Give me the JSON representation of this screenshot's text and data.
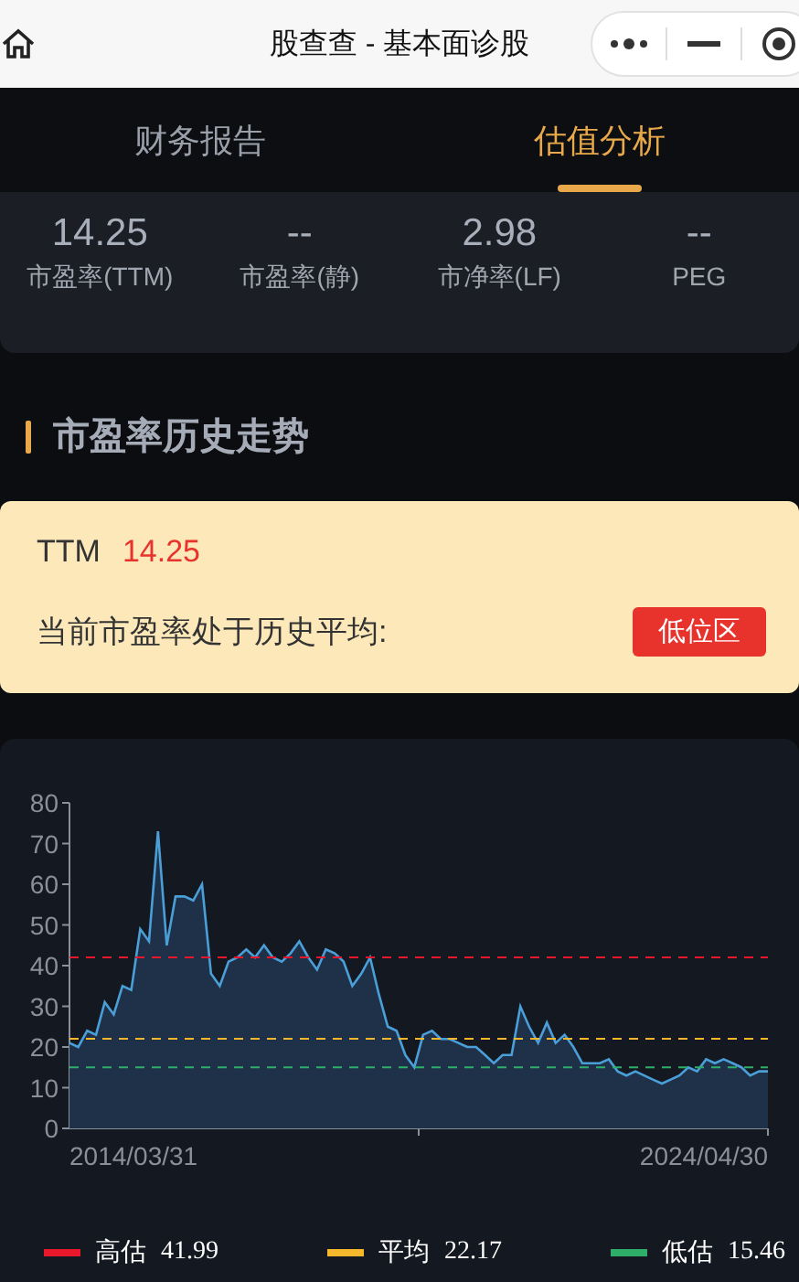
{
  "window": {
    "title": "股查查 - 基本面诊股"
  },
  "tabs": [
    {
      "label": "财务报告",
      "selected": false
    },
    {
      "label": "估值分析",
      "selected": true
    }
  ],
  "metrics": [
    {
      "value": "14.25",
      "label": "市盈率(TTM)"
    },
    {
      "value": "--",
      "label": "市盈率(静)"
    },
    {
      "value": "2.98",
      "label": "市净率(LF)"
    },
    {
      "value": "--",
      "label": "PEG"
    }
  ],
  "section_title": "市盈率历史走势",
  "summary": {
    "label": "TTM",
    "value": "14.25",
    "text": "当前市盈率处于历史平均:",
    "badge": "低位区"
  },
  "chart": {
    "x_axis_labels": [
      "2014/03/31",
      "2024/04/30"
    ],
    "chart_data": {
      "type": "area",
      "ylim": [
        0,
        80
      ],
      "yticks": [
        0,
        10,
        20,
        30,
        40,
        50,
        60,
        70,
        80
      ],
      "series": [
        {
          "color": "#4a9fd8",
          "values": [
            21,
            20,
            24,
            23,
            31,
            28,
            35,
            34,
            49,
            46,
            73,
            45,
            57,
            57,
            56,
            60,
            38,
            35,
            41,
            42,
            44,
            42,
            45,
            42,
            41,
            43,
            46,
            42,
            39,
            44,
            43,
            41,
            35,
            38,
            42,
            33,
            25,
            24,
            18,
            15,
            23,
            24,
            22,
            22,
            21,
            20,
            20,
            18,
            16,
            18,
            18,
            30,
            25,
            21,
            26,
            21,
            23,
            20,
            16,
            16,
            16,
            17,
            14,
            13,
            14,
            13,
            12,
            11,
            12,
            13,
            15,
            14,
            17,
            16,
            17,
            16,
            15,
            13,
            14,
            14
          ]
        }
      ],
      "ref_lines": [
        {
          "axis": "y",
          "value": 42,
          "color": "#e8182c"
        },
        {
          "axis": "y",
          "value": 22,
          "color": "#f5b72c"
        },
        {
          "axis": "y",
          "value": 15,
          "color": "#2fae6a"
        }
      ]
    },
    "legend": [
      {
        "label": "高估",
        "value": "41.99",
        "color": "#e8182c"
      },
      {
        "label": "平均",
        "value": "22.17",
        "color": "#f5b72c"
      },
      {
        "label": "低估",
        "value": "15.46",
        "color": "#2fae6a"
      }
    ]
  }
}
